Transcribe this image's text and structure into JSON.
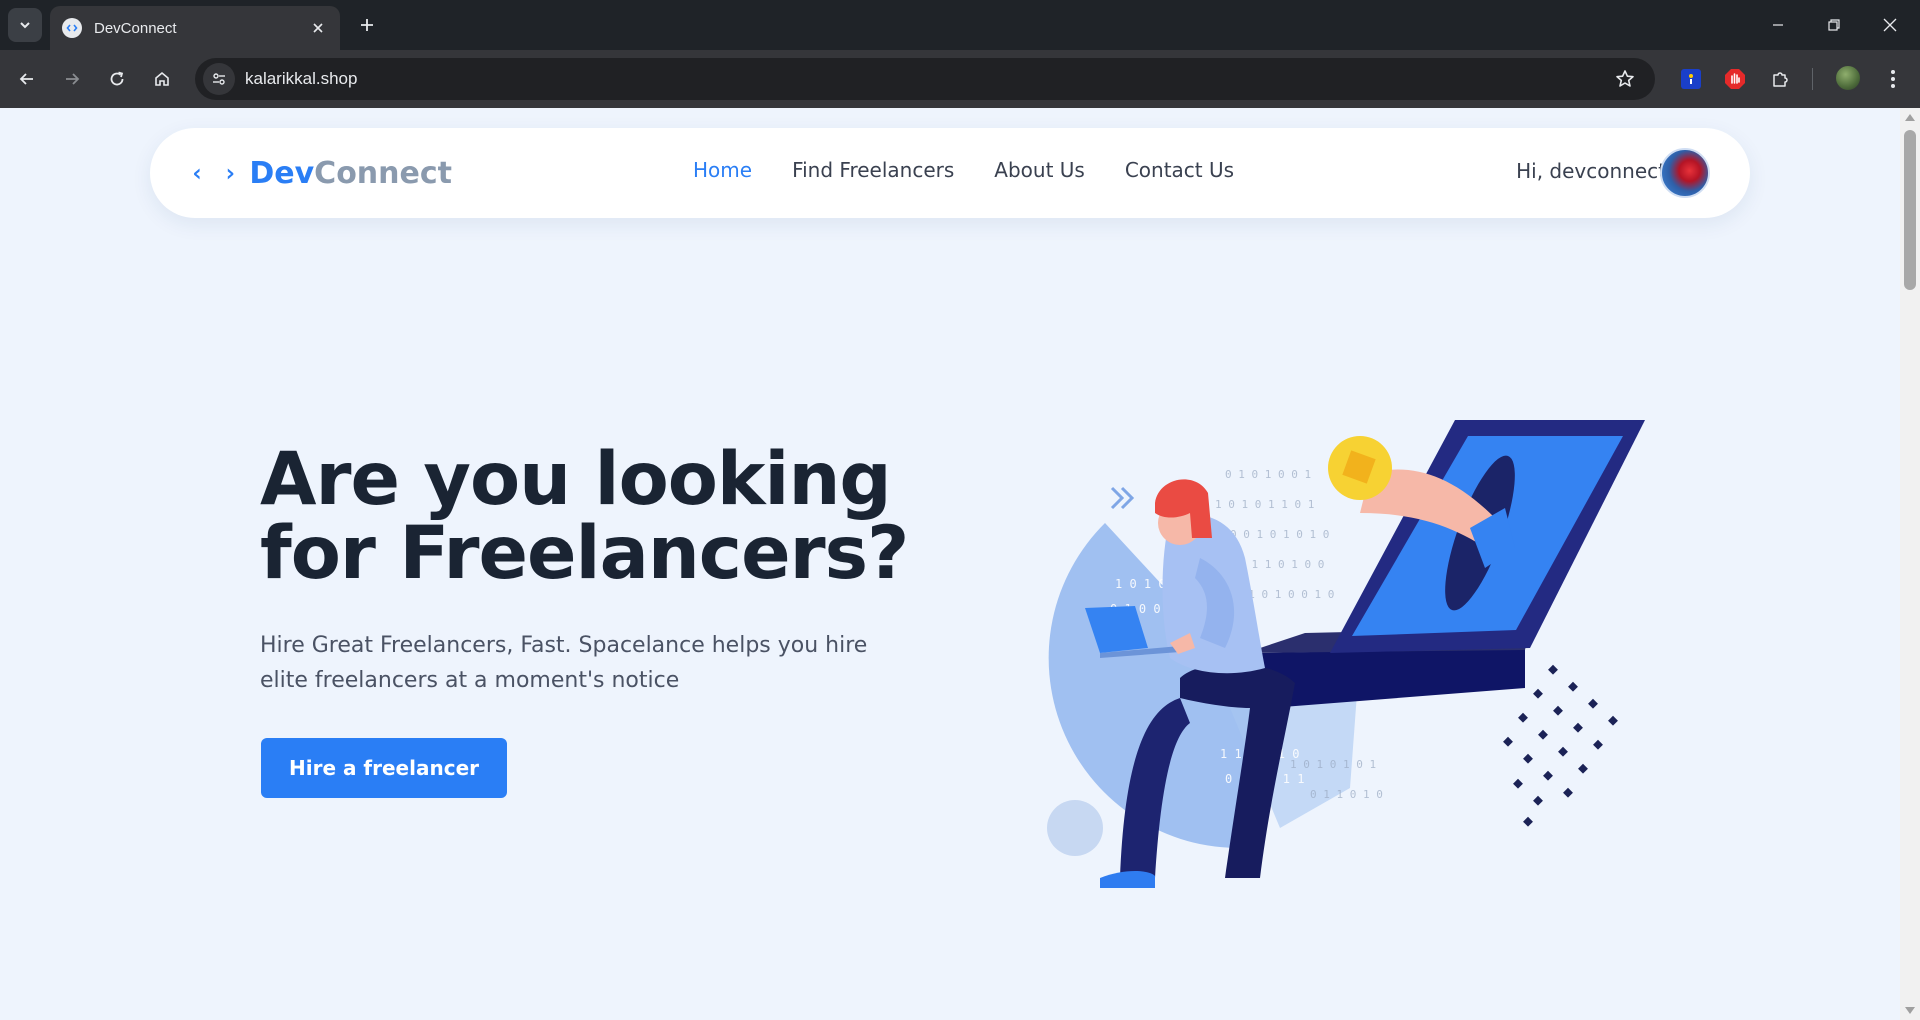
{
  "browser": {
    "tab_title": "DevConnect",
    "url": "kalarikkal.shop",
    "icons": {
      "tab_list": "chevron-down-icon",
      "tab_close": "close-icon",
      "new_tab": "plus-icon",
      "back": "arrow-left-icon",
      "forward": "arrow-right-icon",
      "reload": "reload-icon",
      "home": "home-icon",
      "site_info": "tune-icon",
      "bookmark": "star-icon",
      "extensions": "puzzle-icon",
      "menu": "more-vert-icon"
    }
  },
  "navbar": {
    "logo_symbol": "‹ ›",
    "logo_primary": "Dev",
    "logo_secondary": "Connect",
    "menu": [
      {
        "label": "Home",
        "active": true
      },
      {
        "label": "Find Freelancers",
        "active": false
      },
      {
        "label": "About Us",
        "active": false
      },
      {
        "label": "Contact Us",
        "active": false
      }
    ],
    "greeting": "Hi, devconnect"
  },
  "hero": {
    "title_line1": "Are you looking",
    "title_line2": "for Freelancers?",
    "subtitle": "Hire Great Freelancers, Fast. Spacelance helps you hire elite freelancers at a moment's notice",
    "cta_label": "Hire a freelancer"
  },
  "colors": {
    "accent": "#2a7ef5",
    "logo_secondary": "#8a9aae",
    "heading": "#1a2433",
    "page_bg": "#eef4fd"
  }
}
